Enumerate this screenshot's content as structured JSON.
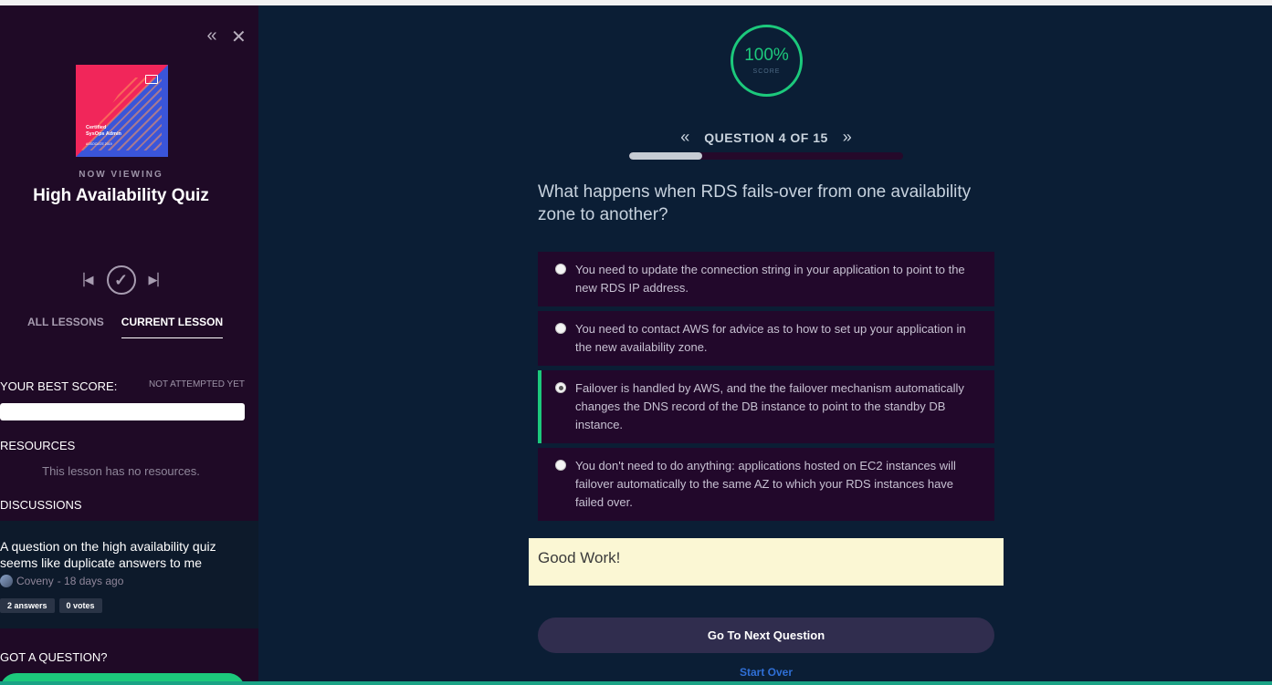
{
  "sidebar": {
    "collapse_icon": "double-chevron-left-icon",
    "close_icon": "close-icon",
    "course_cover": {
      "line1": "Certified",
      "line2": "SysOps Admin",
      "line3": "ASSOCIATE 2019"
    },
    "now_viewing": "NOW VIEWING",
    "lesson_title": "High Availability Quiz",
    "player": {
      "prev_icon": "skip-previous-icon",
      "complete_icon": "check-circle-icon",
      "next_icon": "skip-next-icon"
    },
    "tabs": [
      {
        "label": "ALL LESSONS",
        "active": false
      },
      {
        "label": "CURRENT LESSON",
        "active": true
      }
    ],
    "best_score_label": "YOUR BEST SCORE:",
    "best_score_value": "NOT ATTEMPTED YET",
    "resources_label": "RESOURCES",
    "no_resources": "This lesson has no resources.",
    "discussions_label": "DISCUSSIONS",
    "discussion": {
      "title": "A question on the high availability quiz seems like duplicate answers to me",
      "author": "Coveny",
      "age": "- 18 days ago",
      "answers": "2 answers",
      "votes": "0 votes"
    },
    "got_question_label": "GOT A QUESTION?"
  },
  "main": {
    "score": {
      "value": "100%",
      "label": "SCORE"
    },
    "question_nav": {
      "label": "QUESTION 4 OF 15",
      "prev_icon": "double-chevron-left-icon",
      "next_icon": "double-chevron-right-icon"
    },
    "progress_fraction": 0.267,
    "question": "What happens when RDS fails-over from one availability zone to another?",
    "answers": [
      {
        "text": "You need to update the connection string in your application to point to the new RDS IP address.",
        "selected": false
      },
      {
        "text": "You need to contact AWS for advice as to how to set up your application in the new availability zone.",
        "selected": false
      },
      {
        "text": "Failover is handled by AWS, and the the failover mechanism automatically changes the DNS record of the DB instance to point to the standby DB instance.",
        "selected": true
      },
      {
        "text": "You don't need to do anything: applications hosted on EC2 instances will failover automatically to the same AZ to which your RDS instances have failed over.",
        "selected": false
      }
    ],
    "feedback": "Good Work!",
    "next_button": "Go To Next Question",
    "start_over": "Start Over"
  },
  "colors": {
    "sidebar_bg": "#1f0a26",
    "main_bg": "#0b1e35",
    "accent_green": "#1cc97c",
    "answer_bg": "#22082b",
    "link_blue": "#2f6fd6"
  }
}
